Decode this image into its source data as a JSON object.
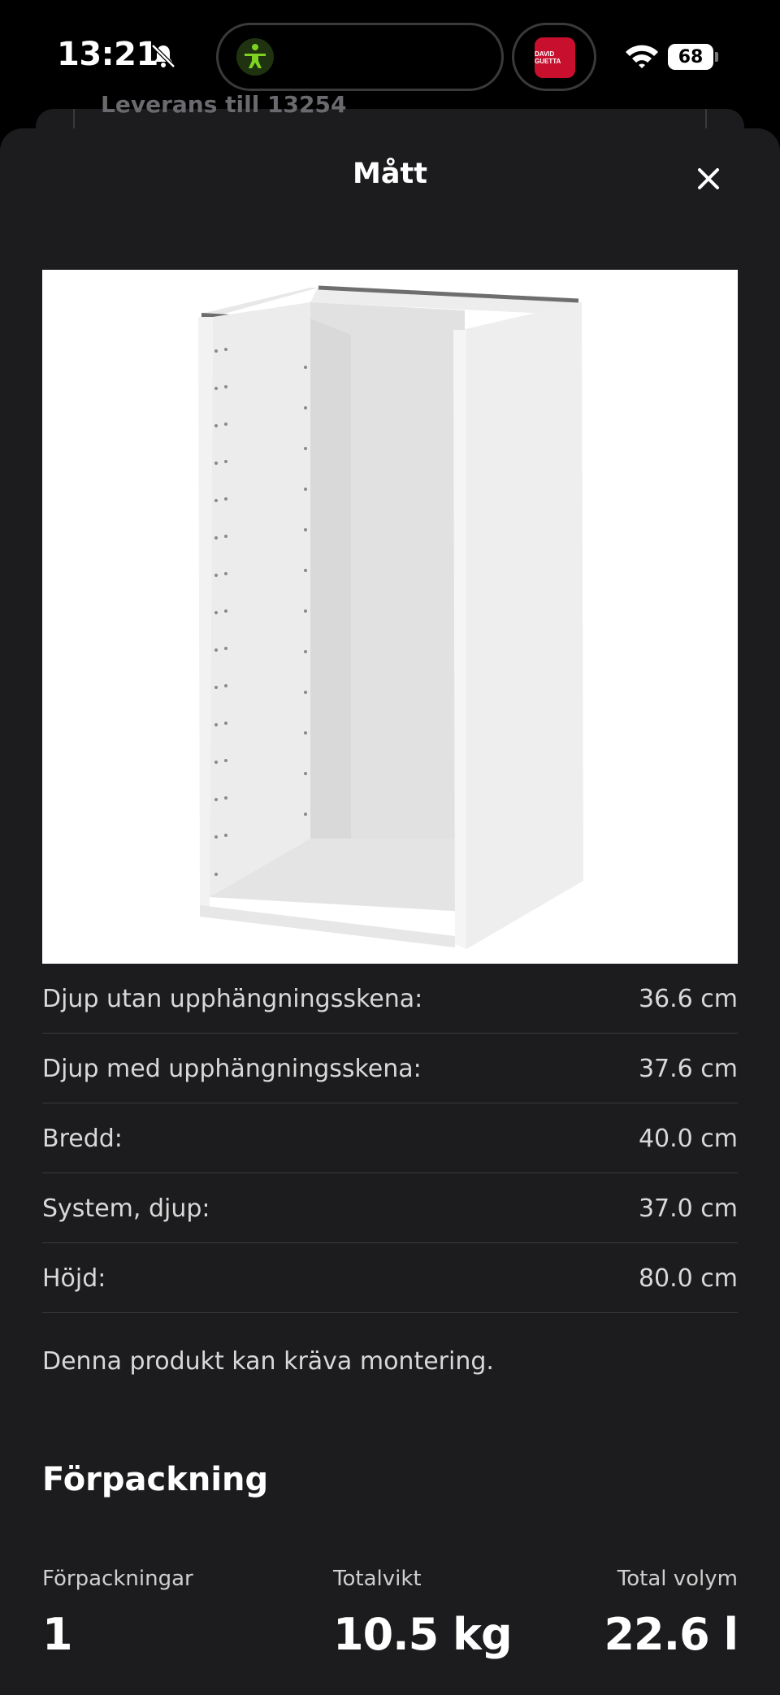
{
  "status_bar": {
    "time": "13:21",
    "battery": "68",
    "album_text": "DAVID GUETTA"
  },
  "background_card": {
    "text": "Leverans till 13254"
  },
  "sheet": {
    "title": "Mått",
    "specs": [
      {
        "label": "Djup utan upphängningsskena:",
        "value": "36.6 cm"
      },
      {
        "label": "Djup med upphängningsskena:",
        "value": "37.6 cm"
      },
      {
        "label": "Bredd:",
        "value": "40.0 cm"
      },
      {
        "label": "System, djup:",
        "value": "37.0 cm"
      },
      {
        "label": "Höjd:",
        "value": "80.0 cm"
      }
    ],
    "note": "Denna produkt kan kräva montering.",
    "packaging": {
      "heading": "Förpackning",
      "items": [
        {
          "label": "Förpackningar",
          "value": "1"
        },
        {
          "label": "Totalvikt",
          "value": "10.5 kg"
        },
        {
          "label": "Total volym",
          "value": "22.6 l"
        }
      ]
    }
  },
  "colors": {
    "sheet_bg": "#1c1c1e",
    "divider": "#3a3a3c",
    "text": "#d8d8d8",
    "accent_fitness": "#7ed321",
    "album": "#c8102e"
  }
}
